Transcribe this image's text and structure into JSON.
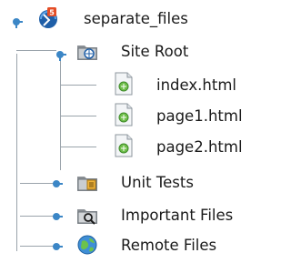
{
  "tree": {
    "root": {
      "label": "separate_files",
      "icon": "html5-project-icon"
    },
    "site_root": {
      "label": "Site Root",
      "icon": "folder-web-icon",
      "children": [
        {
          "label": "index.html",
          "icon": "html-file-icon"
        },
        {
          "label": "page1.html",
          "icon": "html-file-icon"
        },
        {
          "label": "page2.html",
          "icon": "html-file-icon"
        }
      ]
    },
    "unit_tests": {
      "label": "Unit Tests",
      "icon": "test-folder-icon"
    },
    "important_files": {
      "label": "Important Files",
      "icon": "important-files-icon"
    },
    "remote_files": {
      "label": "Remote Files",
      "icon": "globe-icon"
    }
  },
  "colors": {
    "handle_blue": "#3b86c6",
    "tree_line": "#9aa3ab",
    "html5_red": "#e44d26",
    "project_blue": "#1f5fa8"
  }
}
